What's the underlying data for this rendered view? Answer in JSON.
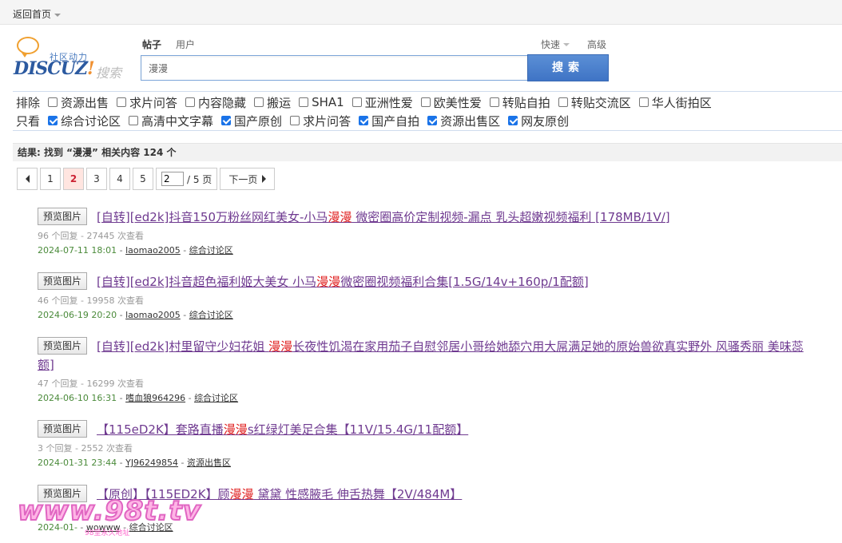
{
  "topbar": {
    "home_label": "返回首页"
  },
  "logo": {
    "slogan": "社区动力",
    "brand": "DISCUZ",
    "brand_mark": "!",
    "search_word": "搜索"
  },
  "search": {
    "tabs": [
      {
        "label": "帖子",
        "active": true
      },
      {
        "label": "用户",
        "active": false
      }
    ],
    "quick_label": "快速",
    "advanced_label": "高级",
    "query": "漫漫",
    "button_label": "搜索"
  },
  "filters": {
    "exclude_label": "排除",
    "exclude_items": [
      {
        "label": "资源出售",
        "checked": false
      },
      {
        "label": "求片问答",
        "checked": false
      },
      {
        "label": "内容隐藏",
        "checked": false
      },
      {
        "label": "搬运",
        "checked": false
      },
      {
        "label": "SHA1",
        "checked": false
      },
      {
        "label": "亚洲性爱",
        "checked": false
      },
      {
        "label": "欧美性爱",
        "checked": false
      },
      {
        "label": "转贴自拍",
        "checked": false
      },
      {
        "label": "转贴交流区",
        "checked": false
      },
      {
        "label": "华人街拍区",
        "checked": false
      }
    ],
    "only_label": "只看",
    "only_items": [
      {
        "label": "综合讨论区",
        "checked": true
      },
      {
        "label": "高清中文字幕",
        "checked": false
      },
      {
        "label": "国产原创",
        "checked": true
      },
      {
        "label": "求片问答",
        "checked": false
      },
      {
        "label": "国产自拍",
        "checked": true
      },
      {
        "label": "资源出售区",
        "checked": true
      },
      {
        "label": "网友原创",
        "checked": true
      }
    ]
  },
  "result_summary": "结果: 找到 “漫漫” 相关内容 124 个",
  "pager": {
    "pages": [
      "1",
      "2",
      "3",
      "4",
      "5"
    ],
    "current": "2",
    "input_value": "2",
    "total_label": "/ 5 页",
    "next_label": "下一页"
  },
  "results": [
    {
      "preview_label": "预览图片",
      "title_parts": [
        "[自转][ed2k]抖音150万粉丝网红美女-小马",
        "漫漫",
        " 微密圈高价定制视频-漏点 乳头超嫩视频福利 [178MB/1V/]"
      ],
      "meta": "96 个回复 - 27445 次查看",
      "date": "2024-07-11 18:01",
      "author": "laomao2005",
      "forum": "综合讨论区"
    },
    {
      "preview_label": "预览图片",
      "title_parts": [
        "[自转][ed2k]抖音超色福利姬大美女 小马",
        "漫漫",
        "微密圈视频福利合集[1.5G/14v+160p/1配额]"
      ],
      "meta": "46 个回复 - 19958 次查看",
      "date": "2024-06-19 20:20",
      "author": "laomao2005",
      "forum": "综合讨论区"
    },
    {
      "preview_label": "预览图片",
      "title_parts": [
        "[自转][ed2k]村里留守少妇花姐 ",
        "漫漫",
        "长夜性饥渴在家用茄子自慰邻居小哥给她舔穴用大屌满足她的原始兽欲真实野外 风骚秀丽 美味蕊",
        "额]"
      ],
      "meta": "47 个回复 - 16299 次查看",
      "date": "2024-06-10 16:31",
      "author": "嗜血狼964296",
      "forum": "综合讨论区"
    },
    {
      "preview_label": "预览图片",
      "title_parts": [
        "【115eD2K】套路直播",
        "漫漫",
        "s红绿灯美足合集【11V/15.4G/11配额】"
      ],
      "meta": "3 个回复 - 2552 次查看",
      "date": "2024-01-31 23:44",
      "author": "YJ96249854",
      "forum": "资源出售区"
    },
    {
      "preview_label": "预览图片",
      "title_parts": [
        "【原创】【115ED2K】顾",
        "漫漫",
        " 黛黛 性感腋毛 伸舌热舞【2V/484M】"
      ],
      "meta": "",
      "date": "2024-01-",
      "author": "wowww",
      "forum": "综合讨论区"
    }
  ],
  "watermark": {
    "text": "www.98t.tv",
    "sub": "98堂永久地址"
  }
}
